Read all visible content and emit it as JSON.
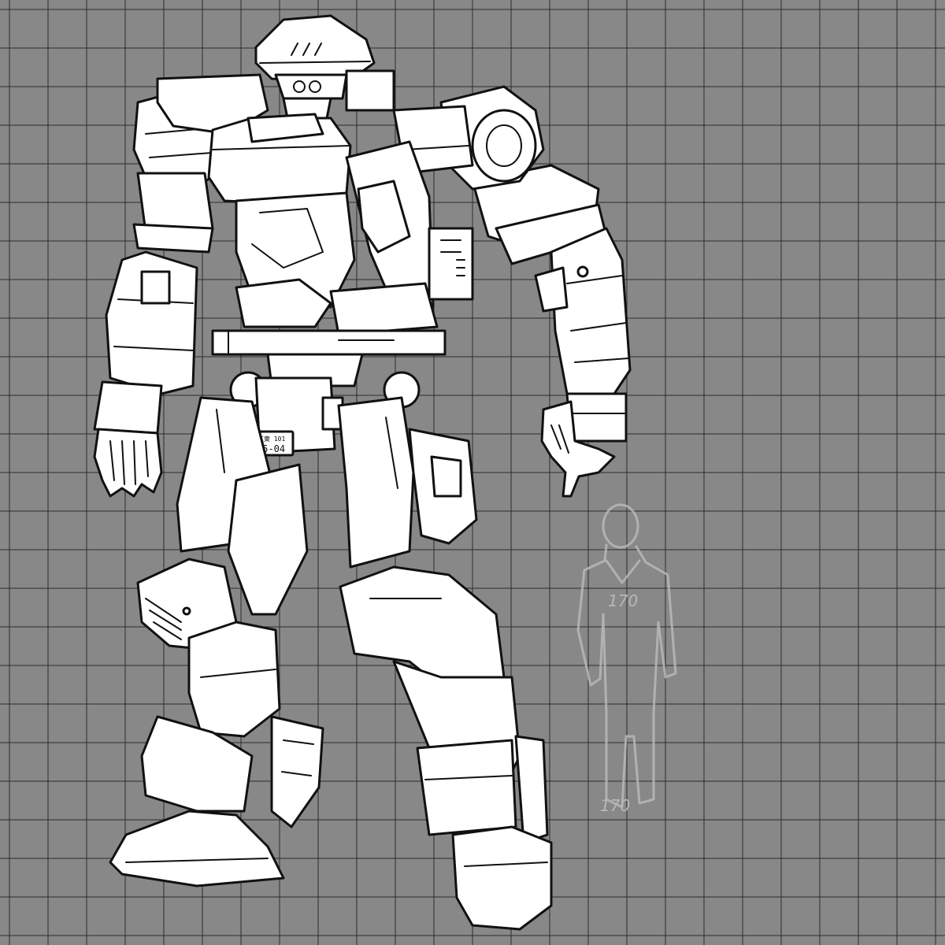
{
  "colors": {
    "background": "#888888",
    "grid_line": "#2b2b2b",
    "ink": "#111111",
    "fill": "#ffffff",
    "ghost_figure": "#b8b8b8"
  },
  "drawing": {
    "subject": "mech-robot-lineart",
    "plate": {
      "top_text": "江東 101",
      "main_text": "15-04"
    },
    "scale_figure": {
      "label": "170"
    }
  }
}
